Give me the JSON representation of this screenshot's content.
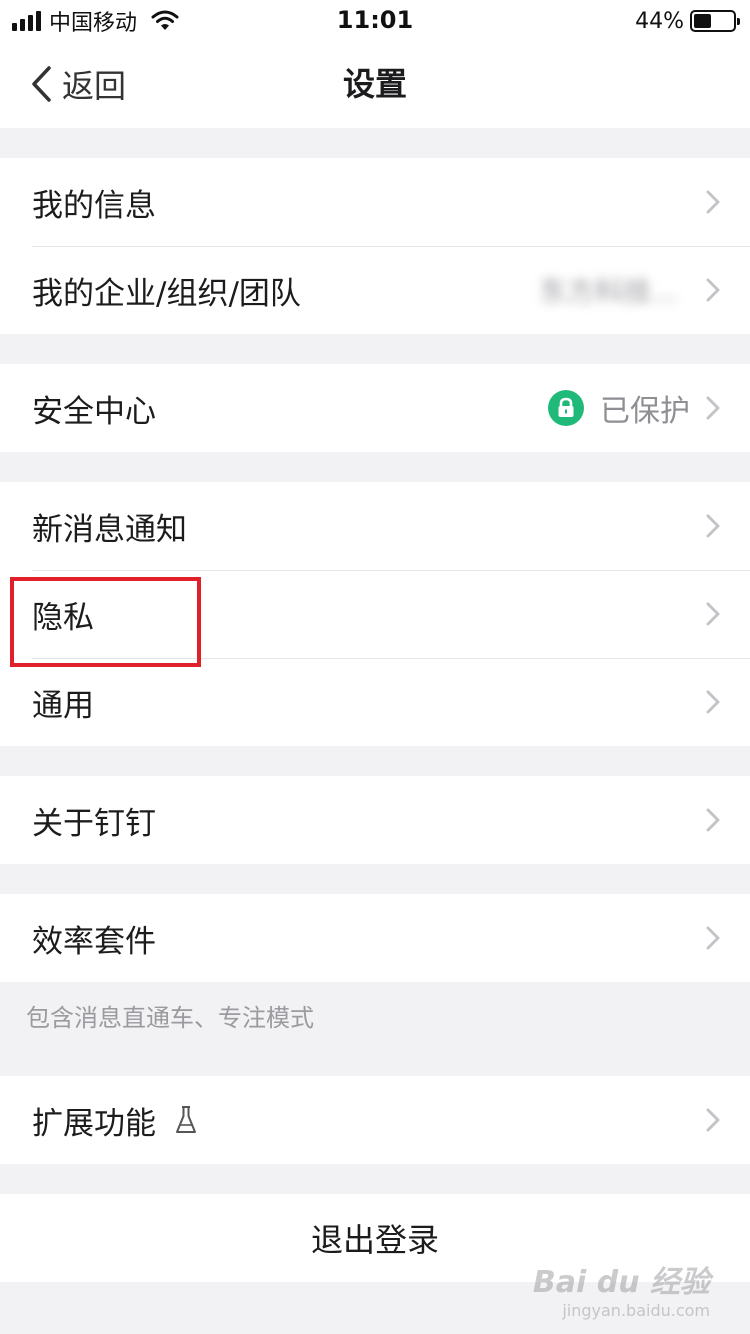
{
  "status_bar": {
    "carrier": "中国移动",
    "time": "11:01",
    "battery_percent_text": "44%",
    "battery_level": 0.44
  },
  "nav": {
    "back_label": "返回",
    "title": "设置"
  },
  "groups": [
    {
      "rows": [
        {
          "label": "我的信息"
        },
        {
          "label": "我的企业/组织/团队",
          "value": "东方科技..."
        }
      ]
    },
    {
      "rows": [
        {
          "label": "安全中心",
          "value": "已保护"
        }
      ]
    },
    {
      "rows": [
        {
          "label": "新消息通知"
        },
        {
          "label": "隐私"
        },
        {
          "label": "通用"
        }
      ]
    },
    {
      "rows": [
        {
          "label": "关于钉钉"
        }
      ]
    },
    {
      "rows": [
        {
          "label": "效率套件"
        }
      ],
      "note": "包含消息直通车、专注模式"
    },
    {
      "rows": [
        {
          "label": "扩展功能"
        }
      ]
    }
  ],
  "logout_label": "退出登录",
  "watermark": {
    "main": "Bai du 经验",
    "sub": "jingyan.baidu.com"
  },
  "colors": {
    "accent_green": "#1fba7a",
    "highlight_red": "#e0202a",
    "background": "#f2f2f4"
  },
  "icons": {
    "back": "chevron-left-icon",
    "row_arrow": "chevron-right-icon",
    "lock": "lock-icon",
    "lab": "flask-icon"
  }
}
